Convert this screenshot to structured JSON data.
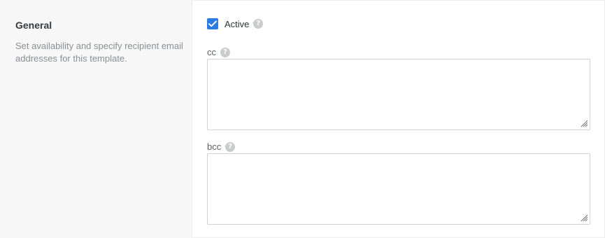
{
  "section": {
    "title": "General",
    "description": "Set availability and specify recipient email addresses for this template."
  },
  "active": {
    "label": "Active",
    "checked": true,
    "help_icon": "question-circle-icon"
  },
  "fields": {
    "cc": {
      "label": "cc",
      "value": "",
      "help_icon": "question-circle-icon"
    },
    "bcc": {
      "label": "bcc",
      "value": "",
      "help_icon": "question-circle-icon"
    }
  },
  "colors": {
    "accent": "#2c7be5",
    "help_icon": "#c9cbcd",
    "left_bg": "#f7f7f7"
  }
}
